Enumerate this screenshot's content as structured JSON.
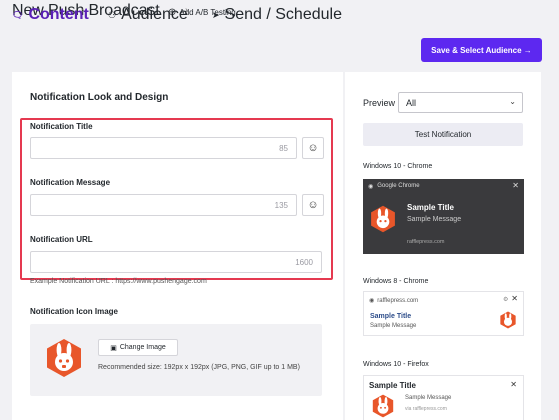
{
  "header": {
    "title": "New Push Broadcast",
    "ab_testing": "Add A/B Testing"
  },
  "steps": [
    {
      "label": "Content",
      "icon": "message-icon",
      "active": true
    },
    {
      "label": "Audience",
      "icon": "users-icon",
      "active": false
    },
    {
      "label": "Send / Schedule",
      "icon": "paper-plane-icon",
      "active": false
    }
  ],
  "primary_button": "Save & Select Audience →",
  "form": {
    "section_title": "Notification Look and Design",
    "title_label": "Notification Title",
    "title_value": "",
    "title_count": "85",
    "message_label": "Notification Message",
    "message_value": "",
    "message_count": "135",
    "url_label": "Notification URL",
    "url_value": "",
    "url_count": "1600",
    "url_example": "Example Notification URL : https://www.pushengage.com",
    "icon_section_title": "Notification Icon Image",
    "change_image": "Change Image",
    "recommended": "Recommended size: 192px x 192px (JPG, PNG, GIF up to 1 MB)"
  },
  "preview": {
    "label": "Preview",
    "selected": "All",
    "test_button": "Test Notification",
    "win10_chrome": {
      "os": "Windows 10 - Chrome",
      "browser": "Google Chrome",
      "title": "Sample Title",
      "message": "Sample Message",
      "site": "rafflepress.com"
    },
    "win8_chrome": {
      "os": "Windows 8 - Chrome",
      "site": "rafflepress.com",
      "title": "Sample Title",
      "message": "Sample Message"
    },
    "win10_firefox": {
      "os": "Windows 10 - Firefox",
      "title": "Sample Title",
      "message": "Sample Message",
      "via": "via rafflepress.com"
    }
  },
  "colors": {
    "accent": "#5d28f0",
    "highlight": "#e53950",
    "logo": "#e8562a"
  }
}
